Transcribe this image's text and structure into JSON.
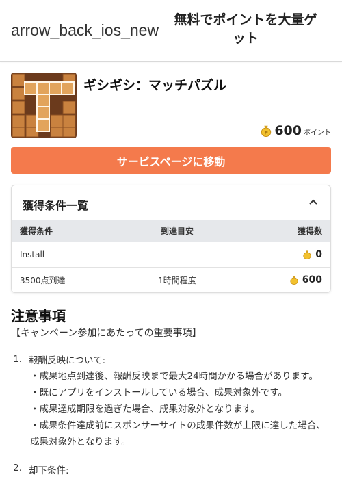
{
  "header": {
    "back_label": "arrow_back_ios_new",
    "title": "無料でポイントを大量ゲット"
  },
  "app": {
    "name": "ギシギシ：マッチパズル",
    "points_value": "600",
    "points_unit": "ポイント",
    "icon_name": "coin-bag-icon"
  },
  "cta": {
    "label": "サービスページに移動",
    "color": "#f47a4c"
  },
  "conditions": {
    "title": "獲得条件一覧",
    "expanded": true,
    "headers": [
      "獲得条件",
      "到達目安",
      "獲得数"
    ],
    "rows": [
      {
        "condition": "Install",
        "estimate": "",
        "reward": "0"
      },
      {
        "condition": "3500点到達",
        "estimate": "1時間程度",
        "reward": "600"
      }
    ]
  },
  "notes": {
    "title": "注意事項",
    "subtitle": "【キャンペーン参加にあたっての重要事項】",
    "items": [
      {
        "number": "1.",
        "heading": "報酬反映について:",
        "lines": [
          "・成果地点到達後、報酬反映まで最大24時間かかる場合があります。",
          "・既にアプリをインストールしている場合、成果対象外です。",
          "・成果達成期限を過ぎた場合、成果対象外となります。",
          "・成果条件達成前にスポンサーサイトの成果件数が上限に達した場合、成果対象外となります。"
        ]
      },
      {
        "number": "2.",
        "heading": "却下条件:"
      }
    ]
  }
}
